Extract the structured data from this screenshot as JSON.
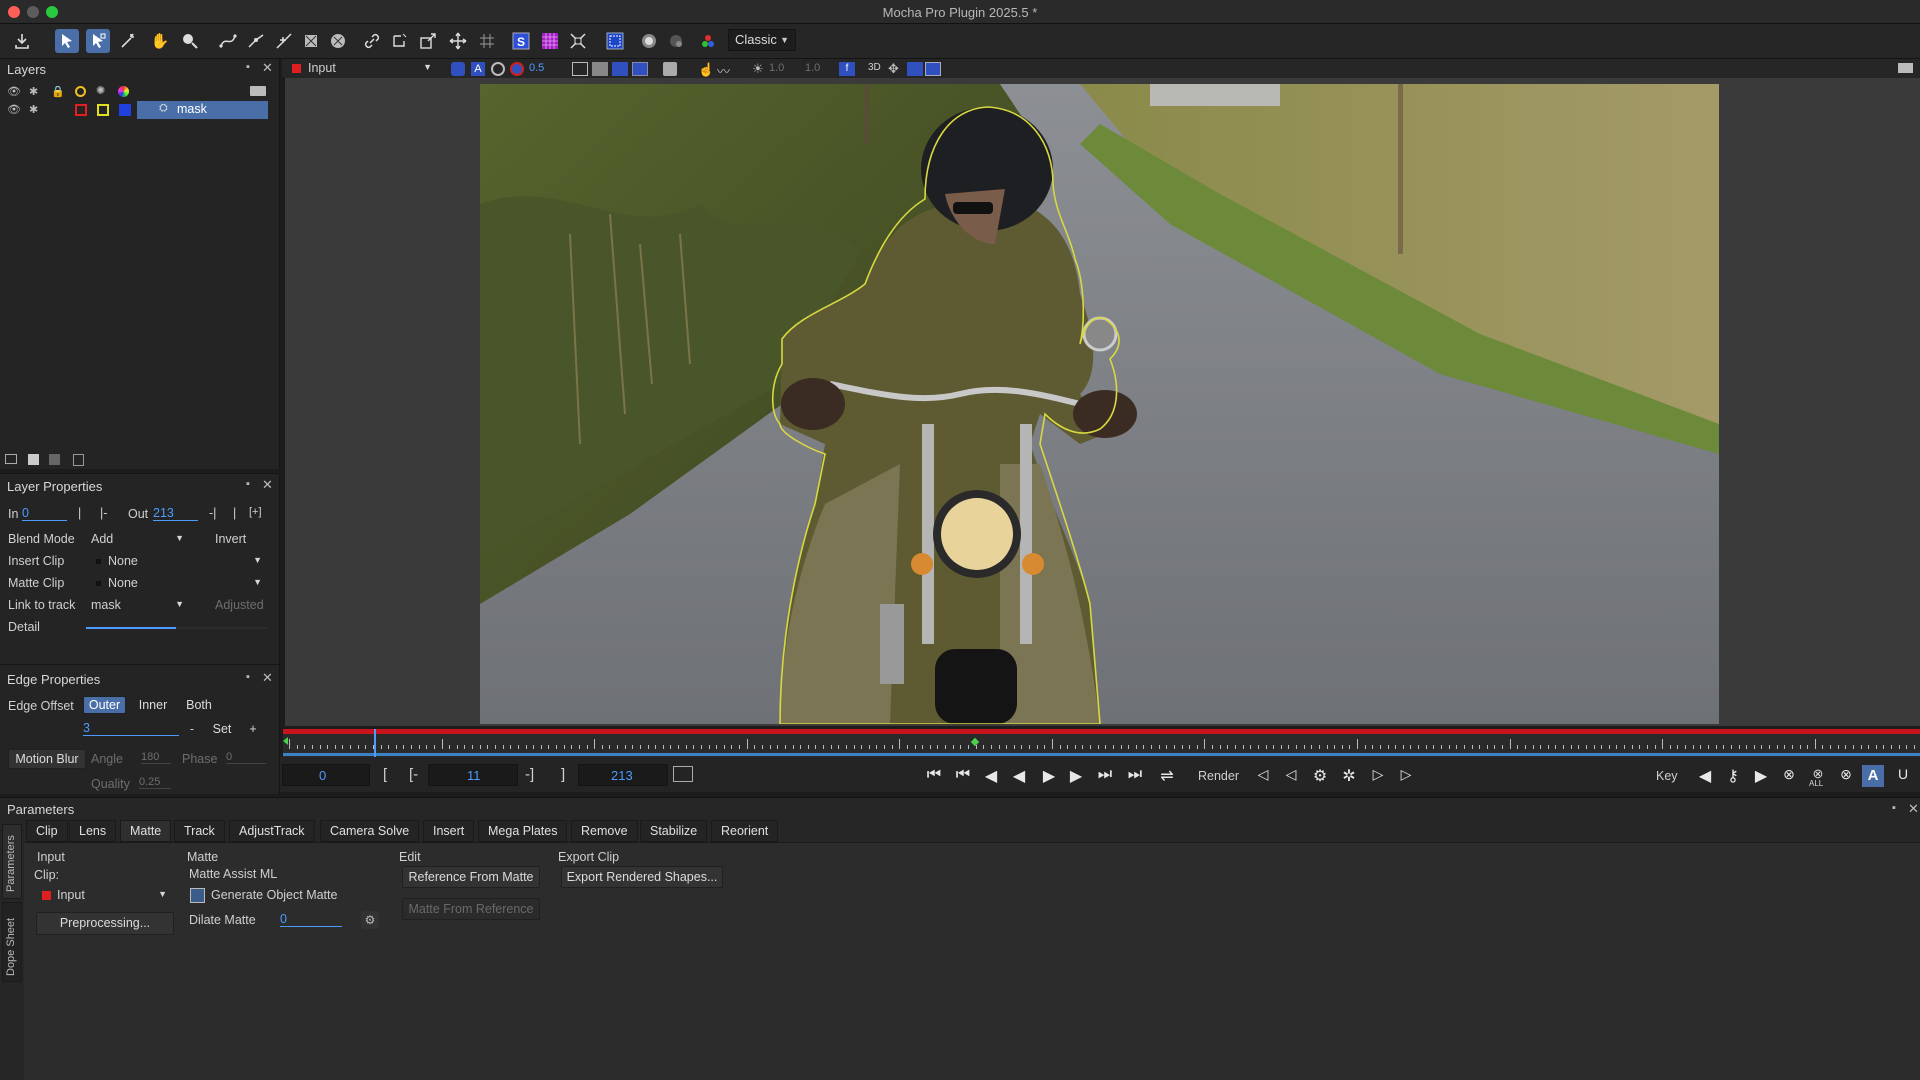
{
  "app": {
    "title": "Mocha Pro Plugin 2025.5 *"
  },
  "toolbar": {
    "view_mode": "Classic"
  },
  "viewer": {
    "clip_select": "Input",
    "zoom_a": "0.5",
    "opacity_a": "1.0",
    "opacity_b": "1.0",
    "label_3d": "3D"
  },
  "layers": {
    "title": "Layers",
    "items": [
      {
        "name": "mask"
      }
    ]
  },
  "layer_properties": {
    "title": "Layer Properties",
    "in_label": "In",
    "in_value": "0",
    "out_label": "Out",
    "out_value": "213",
    "blend_mode_label": "Blend Mode",
    "blend_mode_value": "Add",
    "invert_label": "Invert",
    "insert_clip_label": "Insert Clip",
    "insert_clip_value": "None",
    "matte_clip_label": "Matte Clip",
    "matte_clip_value": "None",
    "link_to_track_label": "Link to track",
    "link_to_track_value": "mask",
    "adjusted_label": "Adjusted",
    "detail_label": "Detail"
  },
  "edge_properties": {
    "title": "Edge Properties",
    "edge_offset_label": "Edge Offset",
    "outer_label": "Outer",
    "inner_label": "Inner",
    "both_label": "Both",
    "offset_value": "3",
    "minus_label": "-",
    "set_label": "Set",
    "plus_label": "+",
    "motion_blur_label": "Motion Blur",
    "angle_label": "Angle",
    "angle_value": "180",
    "phase_label": "Phase",
    "phase_value": "0",
    "quality_label": "Quality",
    "quality_value": "0.25"
  },
  "timeline": {
    "current_frame": "0",
    "in_bracket": "[",
    "in_minus_bracket": "[-",
    "in_value": "11",
    "out_minus_bracket": "-]",
    "out_bracket": "]",
    "out_value": "213",
    "render_label": "Render",
    "key_label": "Key",
    "all_label": "ALL",
    "playhead_fraction": 0.052,
    "keyframe_fraction": 0.42
  },
  "parameters": {
    "title": "Parameters",
    "tabs": [
      "Clip",
      "Lens",
      "Matte",
      "Track",
      "AdjustTrack",
      "Camera Solve",
      "Insert",
      "Mega Plates",
      "Remove",
      "Stabilize",
      "Reorient"
    ],
    "active_tab": "Matte",
    "side_tabs": [
      "Parameters",
      "Dope Sheet"
    ],
    "input_group": "Input",
    "clip_label": "Clip:",
    "clip_value": "Input",
    "preprocessing_label": "Preprocessing...",
    "matte_group": "Matte",
    "matte_assist": "Matte Assist ML",
    "generate_object_matte": "Generate Object Matte",
    "dilate_matte_label": "Dilate Matte",
    "dilate_matte_value": "0",
    "edit_group": "Edit",
    "reference_from_matte": "Reference From Matte",
    "matte_from_reference": "Matte From Reference",
    "export_clip_group": "Export Clip",
    "export_rendered_shapes": "Export Rendered Shapes..."
  },
  "colors": {
    "accent": "#4a6fa8",
    "value_blue": "#4d9bff",
    "timeline_red": "#c8151d",
    "mask_outline": "#d8d840",
    "clip_red": "#e02020"
  }
}
